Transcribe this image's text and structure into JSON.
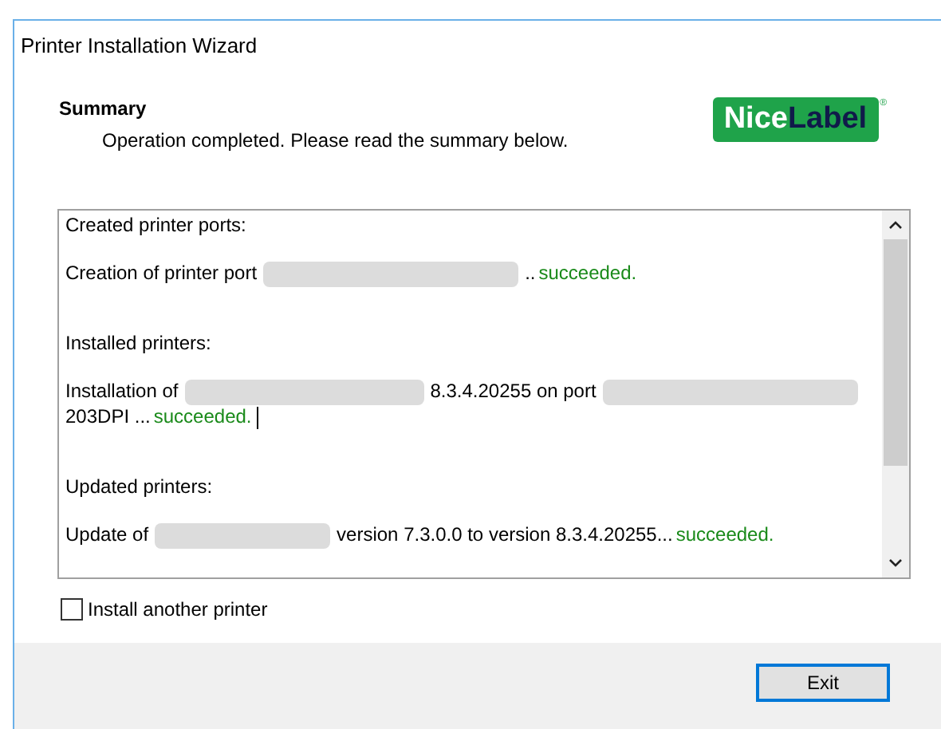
{
  "window": {
    "title": "Printer Installation Wizard"
  },
  "header": {
    "title": "Summary",
    "subtitle": "Operation completed. Please read the summary below.",
    "logo": {
      "first": "Nice",
      "second": "Label",
      "mark": "®"
    }
  },
  "log": [
    {
      "kind": "heading",
      "segments": [
        {
          "kind": "text",
          "text": "Created printer ports:"
        }
      ]
    },
    {
      "kind": "entry",
      "segments": [
        {
          "kind": "text",
          "text": "Creation of printer port"
        },
        {
          "kind": "redacted"
        },
        {
          "kind": "text",
          "text": ".."
        },
        {
          "kind": "success",
          "text": "succeeded."
        }
      ]
    },
    {
      "kind": "gap"
    },
    {
      "kind": "heading",
      "segments": [
        {
          "kind": "text",
          "text": "Installed printers:"
        }
      ]
    },
    {
      "kind": "entry",
      "segments": [
        {
          "kind": "text",
          "text": "Installation of"
        },
        {
          "kind": "redacted"
        },
        {
          "kind": "text",
          "text": "8.3.4.20255 on port"
        },
        {
          "kind": "redacted"
        },
        {
          "kind": "break"
        },
        {
          "kind": "text",
          "text": "203DPI ..."
        },
        {
          "kind": "success",
          "text": "succeeded."
        },
        {
          "kind": "cursor"
        }
      ]
    },
    {
      "kind": "gap"
    },
    {
      "kind": "heading",
      "segments": [
        {
          "kind": "text",
          "text": "Updated printers:"
        }
      ]
    },
    {
      "kind": "entry",
      "segments": [
        {
          "kind": "text",
          "text": "Update of"
        },
        {
          "kind": "redacted"
        },
        {
          "kind": "text",
          "text": "version 7.3.0.0 to version 8.3.4.20255..."
        },
        {
          "kind": "success",
          "text": "succeeded."
        }
      ]
    }
  ],
  "checkbox": {
    "label": "Install another printer",
    "checked": false
  },
  "buttons": [
    {
      "label": "Exit",
      "focused": true
    }
  ]
}
